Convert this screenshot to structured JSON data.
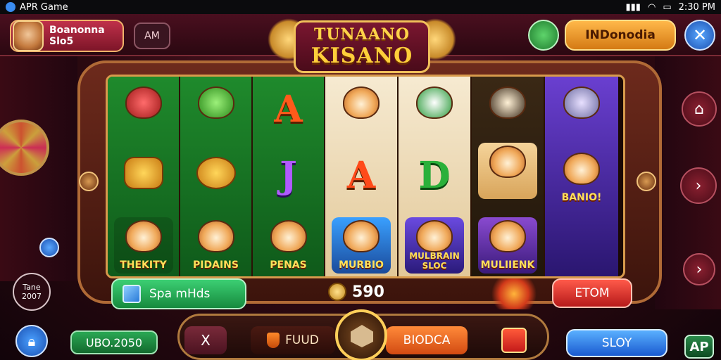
{
  "status_bar": {
    "app_name": "APR Game",
    "time": "2:30 PM",
    "indicators": [
      "signal",
      "wifi",
      "battery"
    ]
  },
  "header": {
    "player_card": {
      "line1": "Boanonna",
      "line2": "Slo5"
    },
    "ag_label": "AM",
    "logo": {
      "line1": "TUNAANO",
      "line2": "KISANO"
    },
    "region_label": "INDonodia",
    "close_icon": "close-icon"
  },
  "reels": [
    {
      "style": "green",
      "symbols": [
        "critter",
        "letter",
        "critter-label"
      ],
      "letters": [
        "",
        "",
        ""
      ],
      "labels": [
        "",
        "",
        "THEKITY"
      ]
    },
    {
      "style": "green",
      "symbols": [
        "critter",
        "critter",
        "critter-label"
      ],
      "letters": [
        "",
        "",
        ""
      ],
      "labels": [
        "",
        "",
        "PIDAINS"
      ]
    },
    {
      "style": "green",
      "symbols": [
        "letter",
        "letter",
        "critter-label"
      ],
      "letters": [
        "A",
        "J",
        ""
      ],
      "labels": [
        "",
        "",
        "PENAS"
      ]
    },
    {
      "style": "cream",
      "symbols": [
        "critter",
        "letter",
        "critter-label"
      ],
      "letters": [
        "",
        "A",
        ""
      ],
      "labels": [
        "",
        "",
        "MURBIO"
      ]
    },
    {
      "style": "cream",
      "symbols": [
        "critter",
        "letter",
        "critter-label"
      ],
      "letters": [
        "",
        "D",
        ""
      ],
      "labels": [
        "",
        "",
        "MULBRAIN SLOC"
      ]
    },
    {
      "style": "dark",
      "symbols": [
        "critter",
        "critter-label",
        "critter-label"
      ],
      "letters": [
        "",
        "",
        ""
      ],
      "labels": [
        "",
        "",
        "MULIIENK"
      ]
    },
    {
      "style": "purple",
      "symbols": [
        "critter",
        "critter-label"
      ],
      "letters": [
        "",
        ""
      ],
      "labels": [
        "",
        "BANIO!"
      ]
    }
  ],
  "controls": {
    "spin_label": "Spa mHds",
    "coin_value": "590",
    "stop_label": "ETOM",
    "balance": "UBO.2050",
    "time_badge": "Tane 2007",
    "x_label": "X",
    "food_label": "FUUD",
    "bioca_label": "BIODCA",
    "slot_label": "SLOY",
    "corner_badge": "AP"
  }
}
